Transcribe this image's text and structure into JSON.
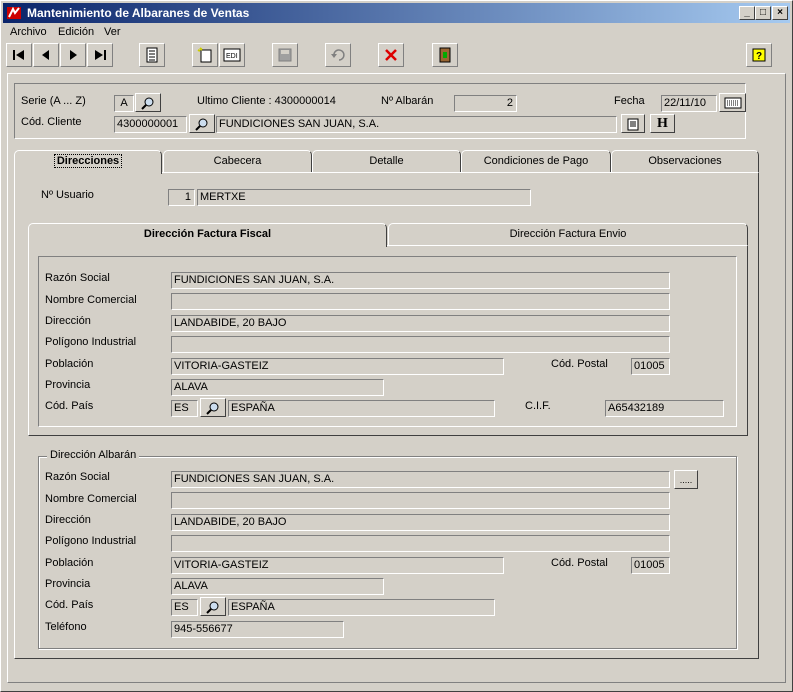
{
  "window": {
    "title": "Mantenimiento de Albaranes de Ventas"
  },
  "menu": [
    "Archivo",
    "Edición",
    "Ver"
  ],
  "header": {
    "serie_label": "Serie (A ... Z)",
    "serie_value": "A",
    "ultimo_cliente": "Ultimo Cliente : 4300000014",
    "albaran_label": "Nº Albarán",
    "albaran_value": "2",
    "fecha_label": "Fecha",
    "fecha_value": "22/11/10",
    "cliente_label": "Cód. Cliente",
    "cliente_code": "4300000001",
    "cliente_name": "FUNDICIONES SAN JUAN, S.A.",
    "h_label": "H"
  },
  "tabs": [
    "Direcciones",
    "Cabecera",
    "Detalle",
    "Condiciones de Pago",
    "Observaciones"
  ],
  "usuario": {
    "label": "Nº Usuario",
    "num": "1",
    "name": "MERTXE"
  },
  "subtabs": [
    "Dirección Factura Fiscal",
    "Dirección Factura Envio"
  ],
  "fiscal": {
    "razon_label": "Razón Social",
    "razon": "FUNDICIONES SAN JUAN, S.A.",
    "nombre_label": "Nombre Comercial",
    "nombre": "",
    "direccion_label": "Dirección",
    "direccion": "LANDABIDE, 20 BAJO",
    "poligono_label": "Polígono Industrial",
    "poligono": "",
    "poblacion_label": "Población",
    "poblacion": "VITORIA-GASTEIZ",
    "cp_label": "Cód. Postal",
    "cp": "01005",
    "provincia_label": "Provincia",
    "provincia": "ALAVA",
    "pais_label": "Cód. País",
    "pais_code": "ES",
    "pais_name": "ESPAÑA",
    "cif_label": "C.I.F.",
    "cif": "A65432189"
  },
  "albaran": {
    "legend": "Dirección Albarán",
    "razon_label": "Razón Social",
    "razon": "FUNDICIONES SAN JUAN, S.A.",
    "nombre_label": "Nombre Comercial",
    "nombre": "",
    "direccion_label": "Dirección",
    "direccion": "LANDABIDE, 20 BAJO",
    "poligono_label": "Polígono Industrial",
    "poligono": "",
    "poblacion_label": "Población",
    "poblacion": "VITORIA-GASTEIZ",
    "cp_label": "Cód. Postal",
    "cp": "01005",
    "provincia_label": "Provincia",
    "provincia": "ALAVA",
    "pais_label": "Cód. País",
    "pais_code": "ES",
    "pais_name": "ESPAÑA",
    "telefono_label": "Teléfono",
    "telefono": "945-556677",
    "more_label": "....."
  }
}
